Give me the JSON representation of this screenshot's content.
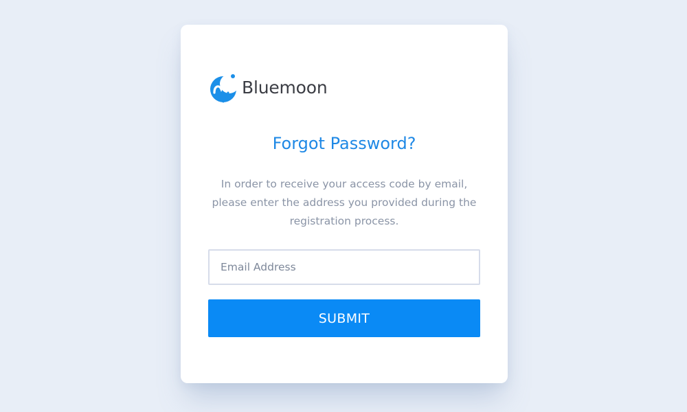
{
  "brand": {
    "name": "Bluemoon",
    "logo_icon": "moon-m-logo-icon",
    "accent_color": "#0a8af5"
  },
  "form": {
    "title": "Forgot Password?",
    "description": "In order to receive your access code by email, please enter the address you provided during the registration process.",
    "email_placeholder": "Email Address",
    "email_value": "",
    "submit_label": "SUBMIT"
  }
}
